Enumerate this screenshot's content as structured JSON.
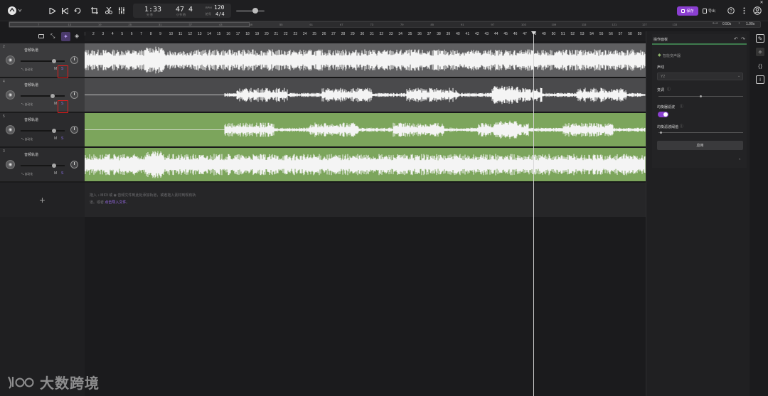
{
  "topbar": {
    "time": "1:33",
    "time_sub": "分  秒",
    "bar": "47",
    "beat": "4",
    "bar_sub": "小节  拍",
    "bpm_label": "BPM",
    "bpm": "120",
    "sig_label": "拍号",
    "signature": "4/4",
    "save_label": "保存",
    "export_label": "导出",
    "icons": [
      "logo-icon",
      "play-icon",
      "rewind-icon",
      "loop-icon",
      "crop-icon",
      "scissors-icon",
      "equalizer-icon",
      "save-icon",
      "export-icon",
      "help-icon",
      "more-icon",
      "account-icon",
      "close-icon"
    ]
  },
  "overview": {
    "ticks": [
      "7",
      "13",
      "19",
      "25",
      "31",
      "37",
      "43",
      "49",
      "55",
      "61",
      "67",
      "73",
      "79",
      "85",
      "91",
      "97",
      "103",
      "109",
      "115",
      "121",
      "127",
      "133"
    ],
    "zoom_h": "0.50x",
    "zoom_v": "1.00x"
  },
  "ruler": {
    "ticks": [
      "2",
      "3",
      "4",
      "5",
      "6",
      "7",
      "8",
      "9",
      "10",
      "11",
      "12",
      "13",
      "14",
      "15",
      "16",
      "17",
      "18",
      "19",
      "20",
      "21",
      "22",
      "23",
      "24",
      "25",
      "26",
      "27",
      "28",
      "29",
      "30",
      "31",
      "32",
      "33",
      "34",
      "35",
      "36",
      "37",
      "38",
      "39",
      "40",
      "41",
      "42",
      "43",
      "44",
      "45",
      "46",
      "47",
      "48",
      "49",
      "50",
      "51",
      "52",
      "53",
      "54",
      "55",
      "56",
      "57",
      "58",
      "59"
    ]
  },
  "tracks": [
    {
      "num": "2",
      "name": "音频轨道",
      "auto": "自动化",
      "mute": "M",
      "solo": "S",
      "vol": 0.75,
      "color": "gray",
      "wave": "full"
    },
    {
      "num": "4",
      "name": "音频轨道",
      "auto": "自动化",
      "mute": "M",
      "solo": "S",
      "vol": 0.72,
      "color": "dark",
      "wave": "late"
    },
    {
      "num": "5",
      "name": "音频轨道",
      "auto": "自动化",
      "mute": "M",
      "solo": "S",
      "vol": 0.75,
      "color": "green",
      "wave": "late"
    },
    {
      "num": "3",
      "name": "音频轨道",
      "auto": "自动化",
      "mute": "M",
      "solo": "S",
      "vol": 0.75,
      "color": "green",
      "wave": "full"
    }
  ],
  "drop_hint": {
    "line1": "拖入 ♪ MIDI 或 ◉ 音频文件到此处添加轨道，或者拖入素材到现有轨",
    "line2_prefix": "道。或者 ",
    "line2_link": "点击导入文件",
    "line2_suffix": "。"
  },
  "add_track_label": "+",
  "op_panel": {
    "title": "操作面板",
    "section": "智能变声器",
    "voice_label": "声线",
    "voice_value": "Y2",
    "pitch_label": "变调",
    "pitch_value": 0.5,
    "filter_label": "均衡器滤波",
    "filter_on": true,
    "threshold_label": "均衡滤波阈值",
    "threshold_value": 0.03,
    "apply_label": "应用"
  },
  "watermark": {
    "text": "大数跨境"
  },
  "colors": {
    "accent": "#8b3fd1",
    "green": "#7ca55c",
    "gray": "#5f5f61",
    "highlight": "#e11d1d"
  }
}
